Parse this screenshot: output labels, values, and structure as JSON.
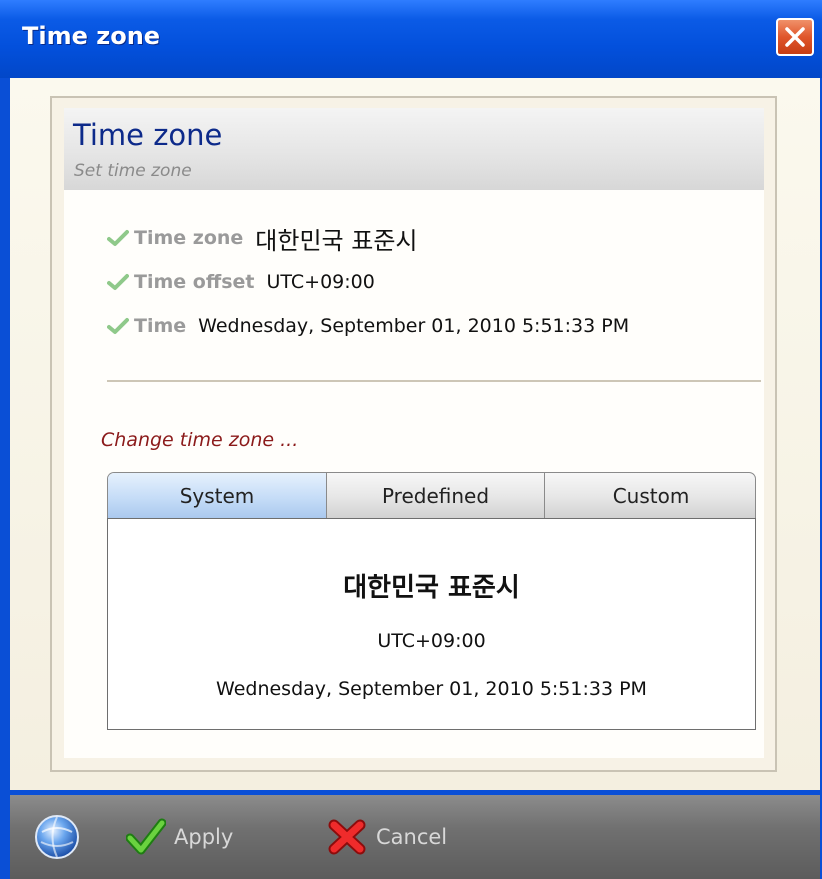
{
  "window": {
    "title": "Time zone",
    "title_bar_color": "#0350dc",
    "close_icon": "close-x-icon"
  },
  "header": {
    "title": "Time zone",
    "subtitle": "Set time zone"
  },
  "info": [
    {
      "icon": "check-icon",
      "label": "Time zone",
      "value": "대한민국 표준시"
    },
    {
      "icon": "check-icon",
      "label": "Time offset",
      "value": "UTC+09:00"
    },
    {
      "icon": "check-icon",
      "label": "Time",
      "value": "Wednesday, September 01, 2010 5:51:33 PM"
    }
  ],
  "change_label": "Change time zone ...",
  "tabs": [
    {
      "label": "System",
      "active": true
    },
    {
      "label": "Predefined",
      "active": false
    },
    {
      "label": "Custom",
      "active": false
    }
  ],
  "tab_content": {
    "name": "대한민국 표준시",
    "offset": "UTC+09:00",
    "time": "Wednesday, September 01, 2010 5:51:33 PM"
  },
  "buttons": {
    "apply": {
      "label": "Apply",
      "icon": "green-check-icon"
    },
    "cancel": {
      "label": "Cancel",
      "icon": "red-x-icon"
    }
  },
  "colors": {
    "header_title": "#0d2a8a",
    "change_label": "#8b1a1a",
    "active_tab": "#c5dcf7"
  }
}
